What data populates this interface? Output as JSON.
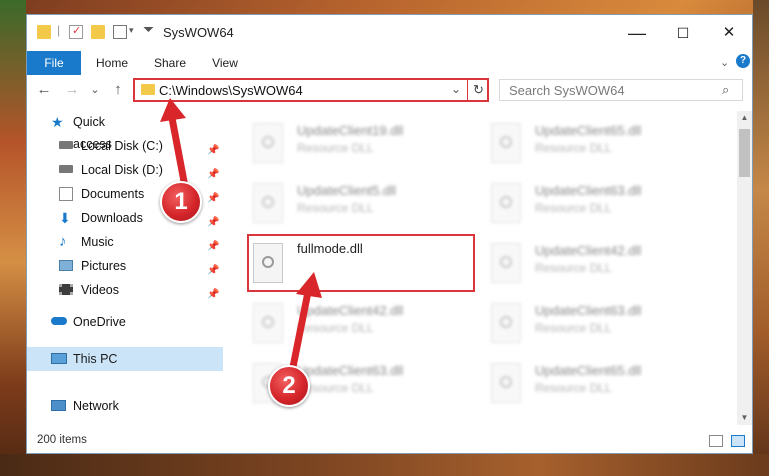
{
  "window": {
    "title": "SysWOW64",
    "controls": {
      "minimize": "—",
      "maximize": "☐",
      "close": "✕",
      "help": "?"
    }
  },
  "ribbon": {
    "tabs": [
      {
        "label": "File"
      },
      {
        "label": "Home"
      },
      {
        "label": "Share"
      },
      {
        "label": "View"
      }
    ]
  },
  "nav": {
    "back": "←",
    "forward": "→",
    "recent": "⌄",
    "up": "↑",
    "address": "C:\\Windows\\SysWOW64",
    "dropdown": "⌄",
    "refresh": "↻",
    "search_placeholder": "Search SysWOW64"
  },
  "sidebar": {
    "items": [
      {
        "label": "Quick access"
      },
      {
        "label": "Local Disk (C:)"
      },
      {
        "label": "Local Disk (D:)"
      },
      {
        "label": "Documents"
      },
      {
        "label": "Downloads"
      },
      {
        "label": "Music"
      },
      {
        "label": "Pictures"
      },
      {
        "label": "Videos"
      },
      {
        "label": "OneDrive"
      },
      {
        "label": "This PC"
      },
      {
        "label": "Network"
      }
    ]
  },
  "files": [
    {
      "name": "UpdateClient19.dll",
      "type": "Resource DLL"
    },
    {
      "name": "UpdateClient65.dll",
      "type": "Resource DLL"
    },
    {
      "name": "UpdateClient5.dll",
      "type": "Resource DLL"
    },
    {
      "name": "UpdateClient63.dll",
      "type": "Resource DLL"
    },
    {
      "name": "fullmode.dll",
      "type": ""
    },
    {
      "name": "UpdateClient42.dll",
      "type": "Resource DLL"
    },
    {
      "name": "UpdateClient42.dll",
      "type": "Resource DLL"
    },
    {
      "name": "UpdateClient63.dll",
      "type": "Resource DLL"
    },
    {
      "name": "UpdateClient63.dll",
      "type": "Resource DLL"
    },
    {
      "name": "UpdateClient65.dll",
      "type": "Resource DLL"
    }
  ],
  "status": {
    "item_count": "200 items"
  },
  "callouts": {
    "step1": "1",
    "step2": "2"
  },
  "colors": {
    "accent": "#1979ca",
    "highlight": "#d9353a",
    "selection": "#cce4f7"
  }
}
